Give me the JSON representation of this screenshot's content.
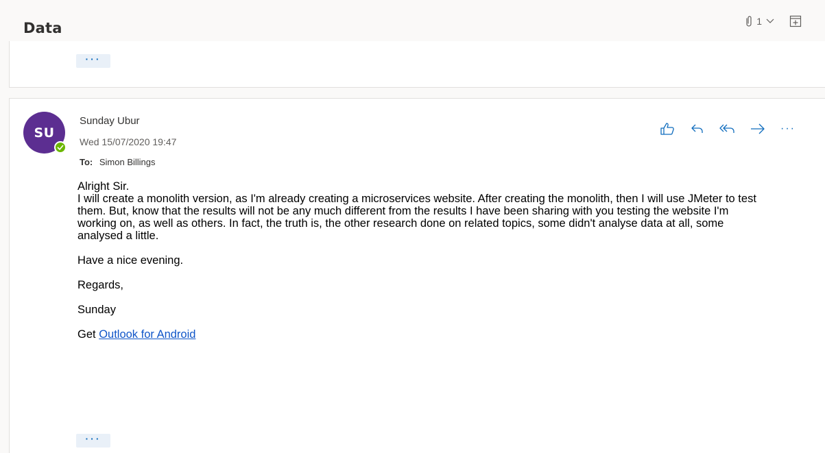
{
  "header": {
    "subject": "Data",
    "attachment_count": "1"
  },
  "collapsed_message": {
    "show_more_label": "···"
  },
  "message": {
    "avatar_initials": "SU",
    "sender_name": "Sunday Ubur",
    "sent_date": "Wed 15/07/2020 19:47",
    "to_label": "To:",
    "to_name": "Simon Billings",
    "body": {
      "greeting": "Alright Sir.",
      "paragraph": "I will create a monolith version, as I'm already creating a microservices website. After creating the monolith,  then I will use JMeter to test them. But, know that the results will not be any much different from the results I have been sharing with you testing the website I'm working on,  as well as others. In fact,  the truth is,  the other research done on related topics,  some didn't analyse data at all, some analysed a little.",
      "closing": "Have a nice evening.",
      "regards": "Regards,",
      "signature": "Sunday",
      "get_prefix": "Get ",
      "link_text": "Outlook for Android"
    },
    "show_more_label": "···",
    "more_actions_label": "···"
  },
  "colors": {
    "avatar_bg": "#5c2e91",
    "presence": "#6bb700",
    "accent": "#0f6cbd",
    "link": "#0f55c8"
  },
  "icons": {
    "attachment": "paperclip-icon",
    "dropdown": "chevron-down-icon",
    "expand": "expand-window-icon",
    "like": "thumbs-up-icon",
    "reply": "reply-icon",
    "reply_all": "reply-all-icon",
    "forward": "forward-icon",
    "more": "more-options-icon"
  }
}
